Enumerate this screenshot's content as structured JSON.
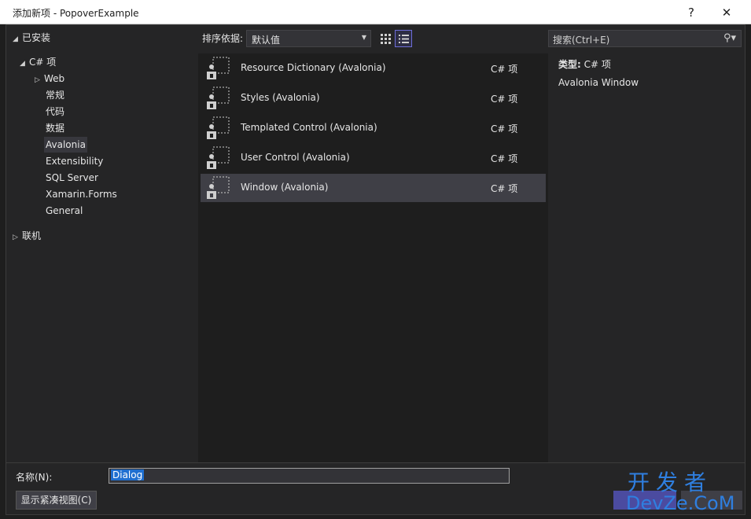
{
  "window": {
    "title": "添加新项 - PopoverExample",
    "help_label": "?",
    "close_label": "✕"
  },
  "tree": {
    "installed": "已安装",
    "csharp": "C# 项",
    "items": [
      "Web",
      "常规",
      "代码",
      "数据",
      "Avalonia",
      "Extensibility",
      "SQL Server",
      "Xamarin.Forms",
      "General"
    ],
    "selected": "Avalonia",
    "online": "联机"
  },
  "sort": {
    "label": "排序依据:",
    "value": "默认值"
  },
  "templates": [
    {
      "name": "Resource Dictionary (Avalonia)",
      "lang": "C# 项"
    },
    {
      "name": "Styles (Avalonia)",
      "lang": "C# 项"
    },
    {
      "name": "Templated Control (Avalonia)",
      "lang": "C# 项"
    },
    {
      "name": "User Control (Avalonia)",
      "lang": "C# 项"
    },
    {
      "name": "Window (Avalonia)",
      "lang": "C# 项"
    }
  ],
  "selected_template": "Window (Avalonia)",
  "search": {
    "placeholder": "搜索(Ctrl+E)"
  },
  "details": {
    "type_label": "类型:",
    "type_value": "C# 项",
    "description": "Avalonia Window"
  },
  "name_field": {
    "label": "名称(N):",
    "value": "Dialog"
  },
  "compact_view_label": "显示紧凑视图(C)",
  "watermark": {
    "line1": "开发者",
    "line2": "DevZe.CoM"
  },
  "colors": {
    "accent": "#6d6dd9",
    "selection": "#3f3f46",
    "watermark": "#2f7fe0"
  }
}
